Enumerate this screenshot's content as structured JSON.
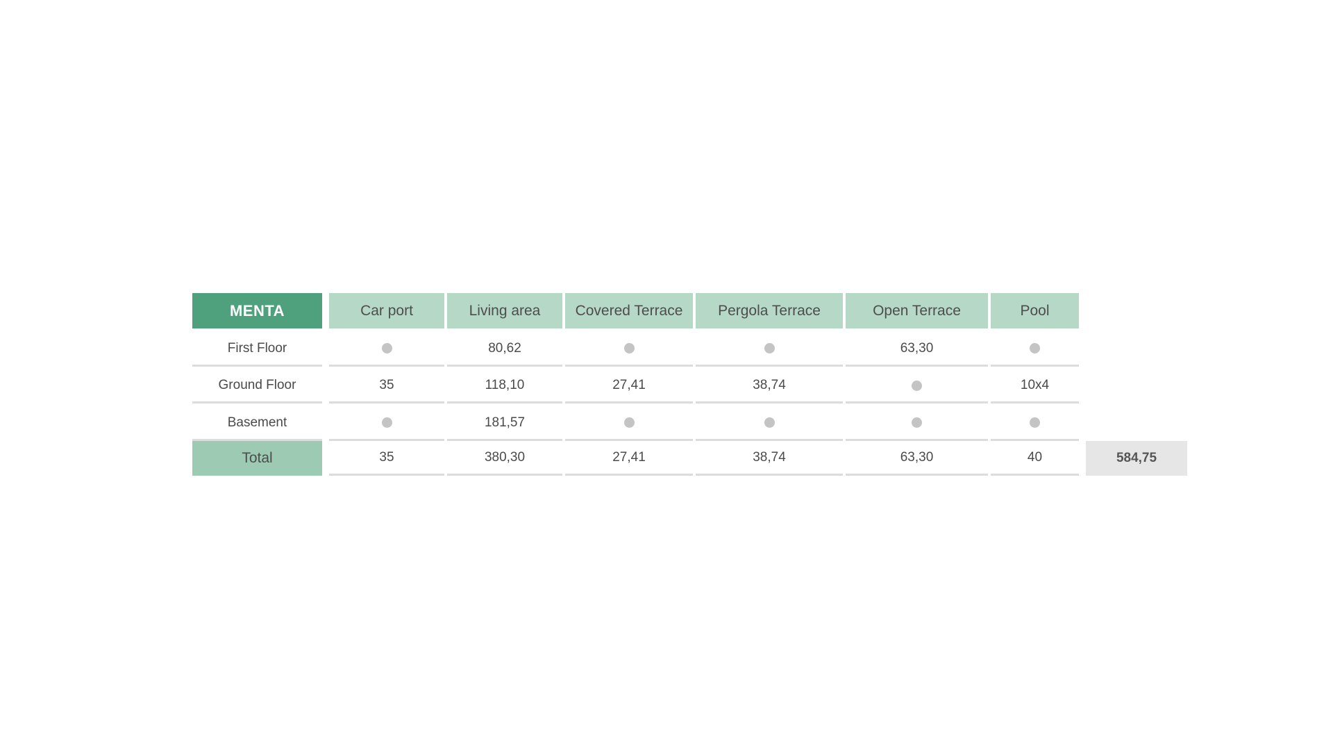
{
  "table": {
    "brand": "MENTA",
    "columns": [
      "Car port",
      "Living area",
      "Covered Terrace",
      "Pergola Terrace",
      "Open Terrace",
      "Pool"
    ],
    "rows": [
      {
        "label": "First Floor",
        "cells": [
          null,
          "80,62",
          null,
          null,
          "63,30",
          null
        ]
      },
      {
        "label": "Ground Floor",
        "cells": [
          "35",
          "118,10",
          "27,41",
          "38,74",
          null,
          "10x4"
        ]
      },
      {
        "label": "Basement",
        "cells": [
          null,
          "181,57",
          null,
          null,
          null,
          null
        ]
      }
    ],
    "total": {
      "label": "Total",
      "cells": [
        "35",
        "380,30",
        "27,41",
        "38,74",
        "63,30",
        "40"
      ],
      "grand_total": "584,75"
    },
    "empty_marker_icon": "dot-icon",
    "colors": {
      "brand": "#4fa07c",
      "header": "#b6d9c7",
      "total_label": "#9ccab3",
      "grand_total_bg": "#e6e6e6",
      "dot": "#c4c4c4"
    }
  }
}
